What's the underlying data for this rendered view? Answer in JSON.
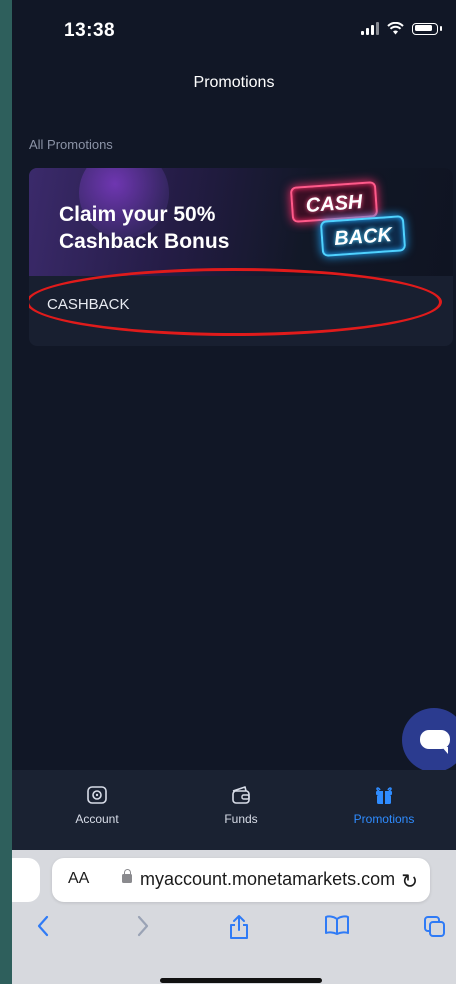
{
  "status": {
    "time": "13:38"
  },
  "header": {
    "title": "Promotions"
  },
  "promotions": {
    "section_label": "All Promotions",
    "card": {
      "banner_line1": "Claim your 50%",
      "banner_line2": "Cashback Bonus",
      "badge_top": "CASH",
      "badge_bottom": "BACK",
      "name": "CASHBACK"
    }
  },
  "tabs": [
    {
      "label": "Account",
      "icon": "account-icon"
    },
    {
      "label": "Funds",
      "icon": "wallet-icon"
    },
    {
      "label": "Promotions",
      "icon": "gift-icon",
      "active": true
    }
  ],
  "browser": {
    "text_size_label": "AA",
    "url": "myaccount.monetamarkets.com"
  },
  "colors": {
    "background": "#111726",
    "accent": "#2f8cff",
    "highlight": "#e01b1b"
  }
}
